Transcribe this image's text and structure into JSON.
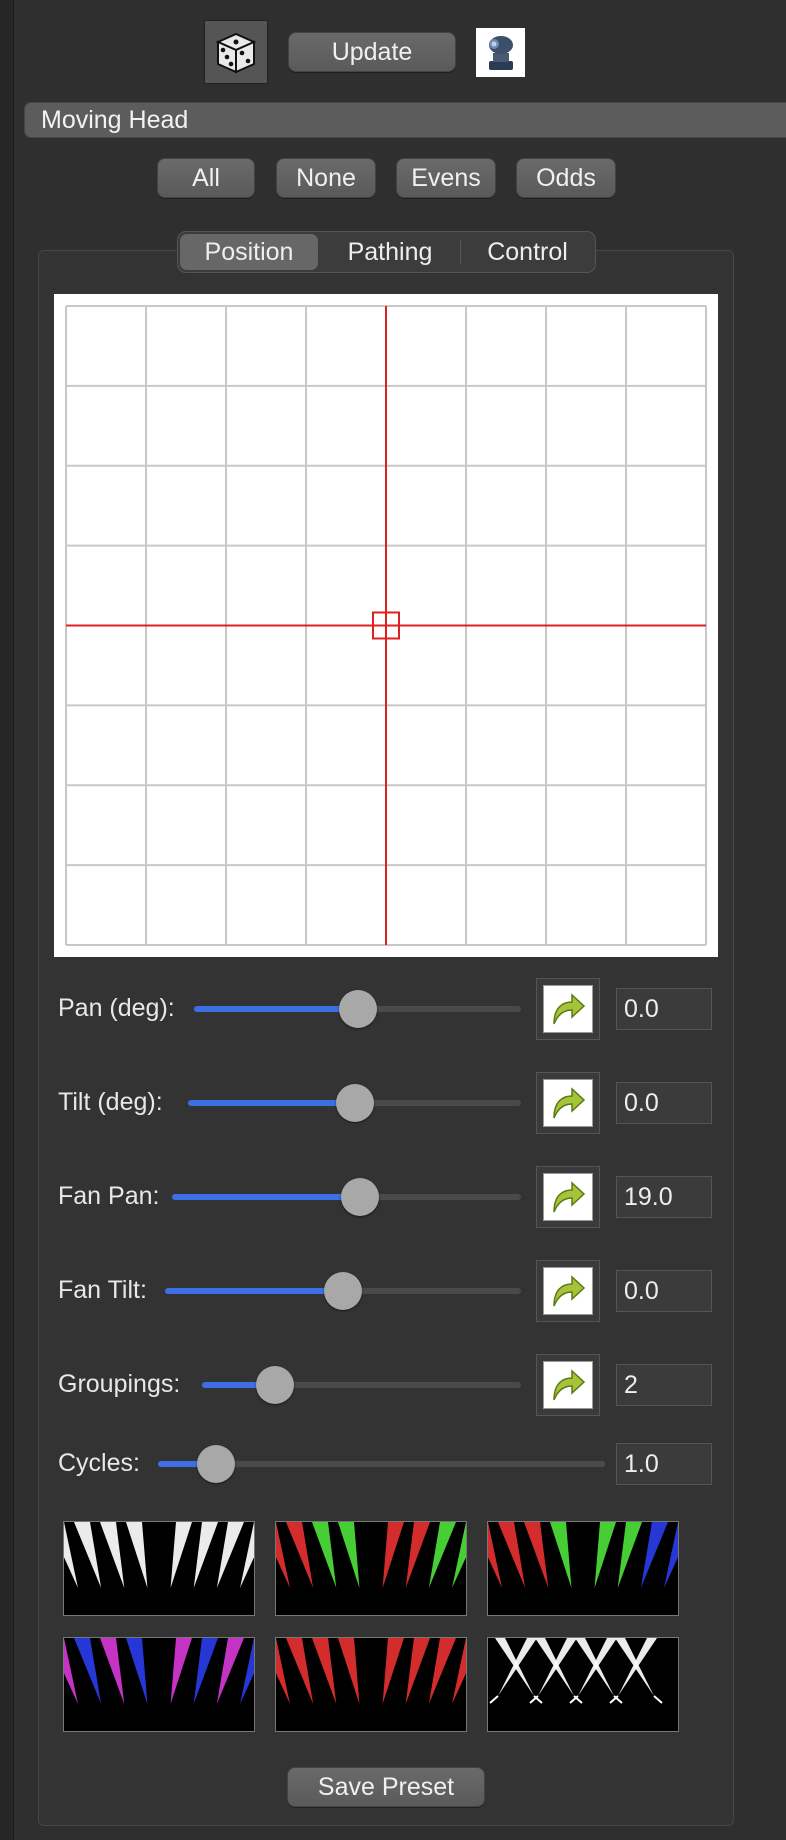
{
  "toolbar": {
    "dice_icon": "dice-icon",
    "update_label": "Update",
    "fixture_icon": "moving-head-fixture-icon"
  },
  "fixture": {
    "name": "Moving Head"
  },
  "selection_buttons": [
    "All",
    "None",
    "Evens",
    "Odds"
  ],
  "tabs": [
    {
      "label": "Position",
      "selected": true
    },
    {
      "label": "Pathing",
      "selected": false
    },
    {
      "label": "Control",
      "selected": false
    }
  ],
  "position_grid": {
    "rows": 8,
    "cols": 8,
    "crosshair_color": "#e02020",
    "grid_color": "#c8c8c8"
  },
  "sliders": [
    {
      "id": "pan",
      "label": "Pan (deg):",
      "value": "0.0",
      "fraction": 0.5,
      "reset_icon": "reset-arrow-icon"
    },
    {
      "id": "tilt",
      "label": "Tilt (deg):",
      "value": "0.0",
      "fraction": 0.5,
      "reset_icon": "reset-arrow-icon"
    },
    {
      "id": "fan-pan",
      "label": "Fan Pan:",
      "value": "19.0",
      "fraction": 0.54,
      "reset_icon": "reset-arrow-icon"
    },
    {
      "id": "fan-tilt",
      "label": "Fan Tilt:",
      "value": "0.0",
      "fraction": 0.5,
      "reset_icon": "reset-arrow-icon"
    },
    {
      "id": "groupings",
      "label": "Groupings:",
      "value": "2",
      "fraction": 0.23,
      "reset_icon": "reset-arrow-icon"
    },
    {
      "id": "cycles",
      "label": "Cycles:",
      "value": "1.0",
      "fraction": 0.13
    }
  ],
  "presets": [
    {
      "name": "white-fan-preset",
      "colors": [
        "#ffffff",
        "#ffffff",
        "#ffffff",
        "#ffffff",
        "#ffffff",
        "#ffffff",
        "#ffffff",
        "#ffffff"
      ]
    },
    {
      "name": "red-green-fan-preset",
      "colors": [
        "#e53030",
        "#e53030",
        "#4ddf3a",
        "#4ddf3a",
        "#e53030",
        "#e53030",
        "#4ddf3a",
        "#4ddf3a"
      ]
    },
    {
      "name": "red-green-blue-fan-preset",
      "colors": [
        "#e53030",
        "#e53030",
        "#e53030",
        "#4ddf3a",
        "#4ddf3a",
        "#4ddf3a",
        "#2a3ce8",
        "#2a3ce8"
      ]
    },
    {
      "name": "magenta-blue-fan-preset",
      "colors": [
        "#d637d6",
        "#2a3ce8",
        "#d637d6",
        "#2a3ce8",
        "#d637d6",
        "#2a3ce8",
        "#d637d6",
        "#2a3ce8"
      ]
    },
    {
      "name": "red-fan-preset",
      "colors": [
        "#e53030",
        "#e53030",
        "#e53030",
        "#e53030",
        "#e53030",
        "#e53030",
        "#e53030",
        "#e53030"
      ]
    },
    {
      "name": "white-crossing-preset",
      "colors": [
        "#ffffff",
        "#ffffff",
        "#ffffff",
        "#ffffff",
        "#ffffff",
        "#ffffff",
        "#ffffff",
        "#ffffff"
      ],
      "crossing": true
    }
  ],
  "save_preset_label": "Save Preset"
}
